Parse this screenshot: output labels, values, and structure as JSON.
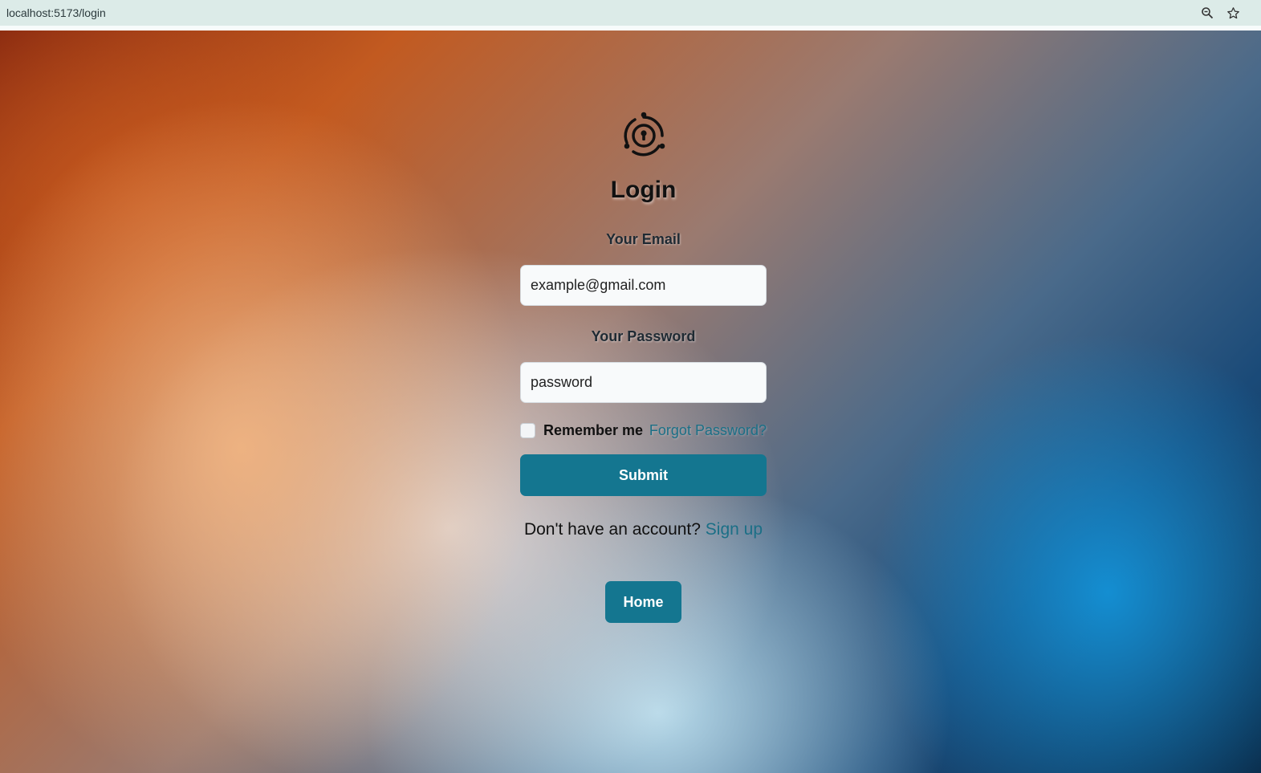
{
  "browser": {
    "url": "localhost:5173/login",
    "icons": [
      "zoom-icon",
      "star-icon"
    ]
  },
  "login": {
    "title": "Login",
    "logo_icon": "lock-orbit-icon",
    "email_label": "Your Email",
    "email_value": "example@gmail.com",
    "password_label": "Your Password",
    "password_value": "password",
    "remember_label": "Remember me",
    "remember_checked": false,
    "forgot_label": "Forgot Password?",
    "submit_label": "Submit",
    "signup_prompt": "Don't have an account?",
    "signup_link": "Sign up",
    "home_label": "Home"
  },
  "colors": {
    "accent": "#147690",
    "link": "#1b6f86"
  }
}
